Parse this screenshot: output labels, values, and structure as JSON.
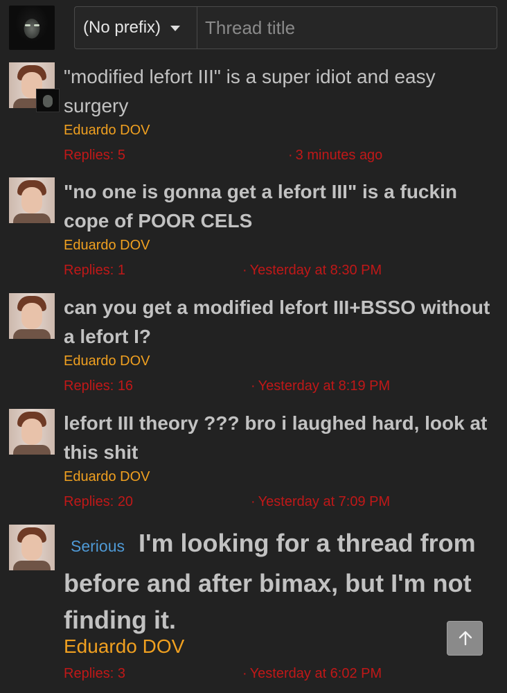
{
  "composer": {
    "prefix_value": "(No prefix)",
    "title_placeholder": "Thread title"
  },
  "threads": [
    {
      "title": "\"modified lefort III\" is a super idiot and easy surgery",
      "author": "Eduardo DOV",
      "replies": "Replies: 5",
      "date": "3 minutes ago"
    },
    {
      "title": "\"no one is gonna get a lefort III\" is a fuckin cope of POOR CELS",
      "author": "Eduardo DOV",
      "replies": "Replies: 1",
      "date": "Yesterday at 8:30 PM"
    },
    {
      "title": "can you get a modified lefort III+BSSO without a lefort I?",
      "author": "Eduardo DOV",
      "replies": "Replies: 16",
      "date": "Yesterday at 8:19 PM"
    },
    {
      "title": "lefort III theory ??? bro i laughed hard, look at this shit",
      "author": "Eduardo DOV",
      "replies": "Replies: 20",
      "date": "Yesterday at 7:09 PM"
    },
    {
      "prefix": "Serious",
      "title": "I'm looking for a thread from before and after bimax, but I'm not finding it.",
      "author": "Eduardo DOV",
      "replies": "Replies: 3",
      "date": "Yesterday at 6:02 PM"
    }
  ],
  "colors": {
    "background": "#222222",
    "author": "#f0a020",
    "meta": "#c01818",
    "prefix_badge": "#4f9ad6"
  },
  "icons": {
    "dropdown": "caret-down-icon",
    "scroll_top": "arrow-up-icon"
  }
}
